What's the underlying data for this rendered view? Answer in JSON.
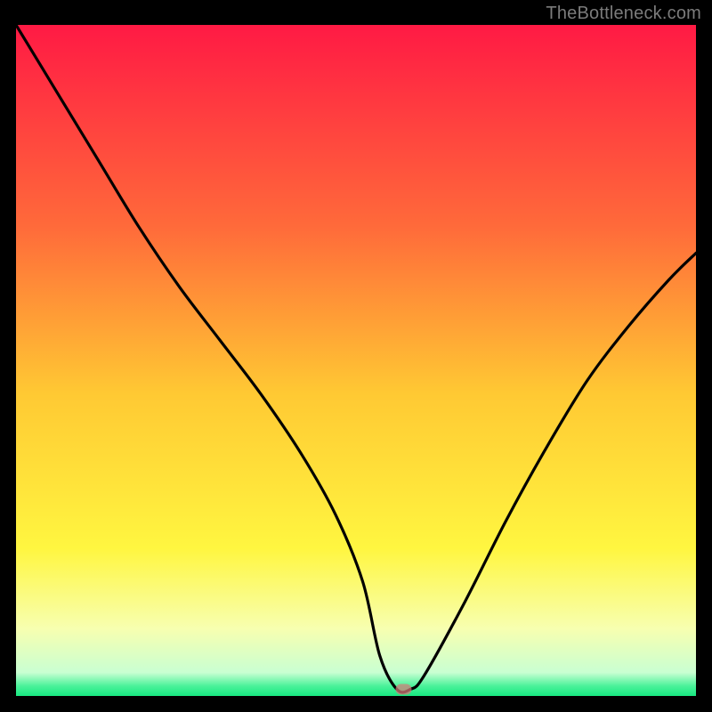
{
  "watermark": "TheBottleneck.com",
  "chart_data": {
    "type": "line",
    "title": "",
    "xlabel": "",
    "ylabel": "",
    "xlim": [
      0,
      100
    ],
    "ylim": [
      0,
      100
    ],
    "gradient_stops": [
      {
        "offset": 0.0,
        "color": "#ff1a44"
      },
      {
        "offset": 0.3,
        "color": "#ff6a3a"
      },
      {
        "offset": 0.55,
        "color": "#ffc933"
      },
      {
        "offset": 0.78,
        "color": "#fff640"
      },
      {
        "offset": 0.9,
        "color": "#f7ffb0"
      },
      {
        "offset": 0.965,
        "color": "#c9ffd2"
      },
      {
        "offset": 0.985,
        "color": "#4bf29a"
      },
      {
        "offset": 1.0,
        "color": "#17e880"
      }
    ],
    "series": [
      {
        "name": "bottleneck-curve",
        "x": [
          0,
          6,
          12,
          18,
          24,
          30,
          36,
          42,
          47,
          51,
          53.5,
          56,
          58,
          60,
          66,
          72,
          78,
          84,
          90,
          96,
          100
        ],
        "y": [
          100,
          90,
          80,
          70,
          61,
          53,
          45,
          36,
          27,
          17,
          6,
          1,
          1,
          3,
          14,
          26,
          37,
          47,
          55,
          62,
          66
        ]
      }
    ],
    "marker": {
      "x": 57,
      "y": 1
    },
    "legend": []
  }
}
